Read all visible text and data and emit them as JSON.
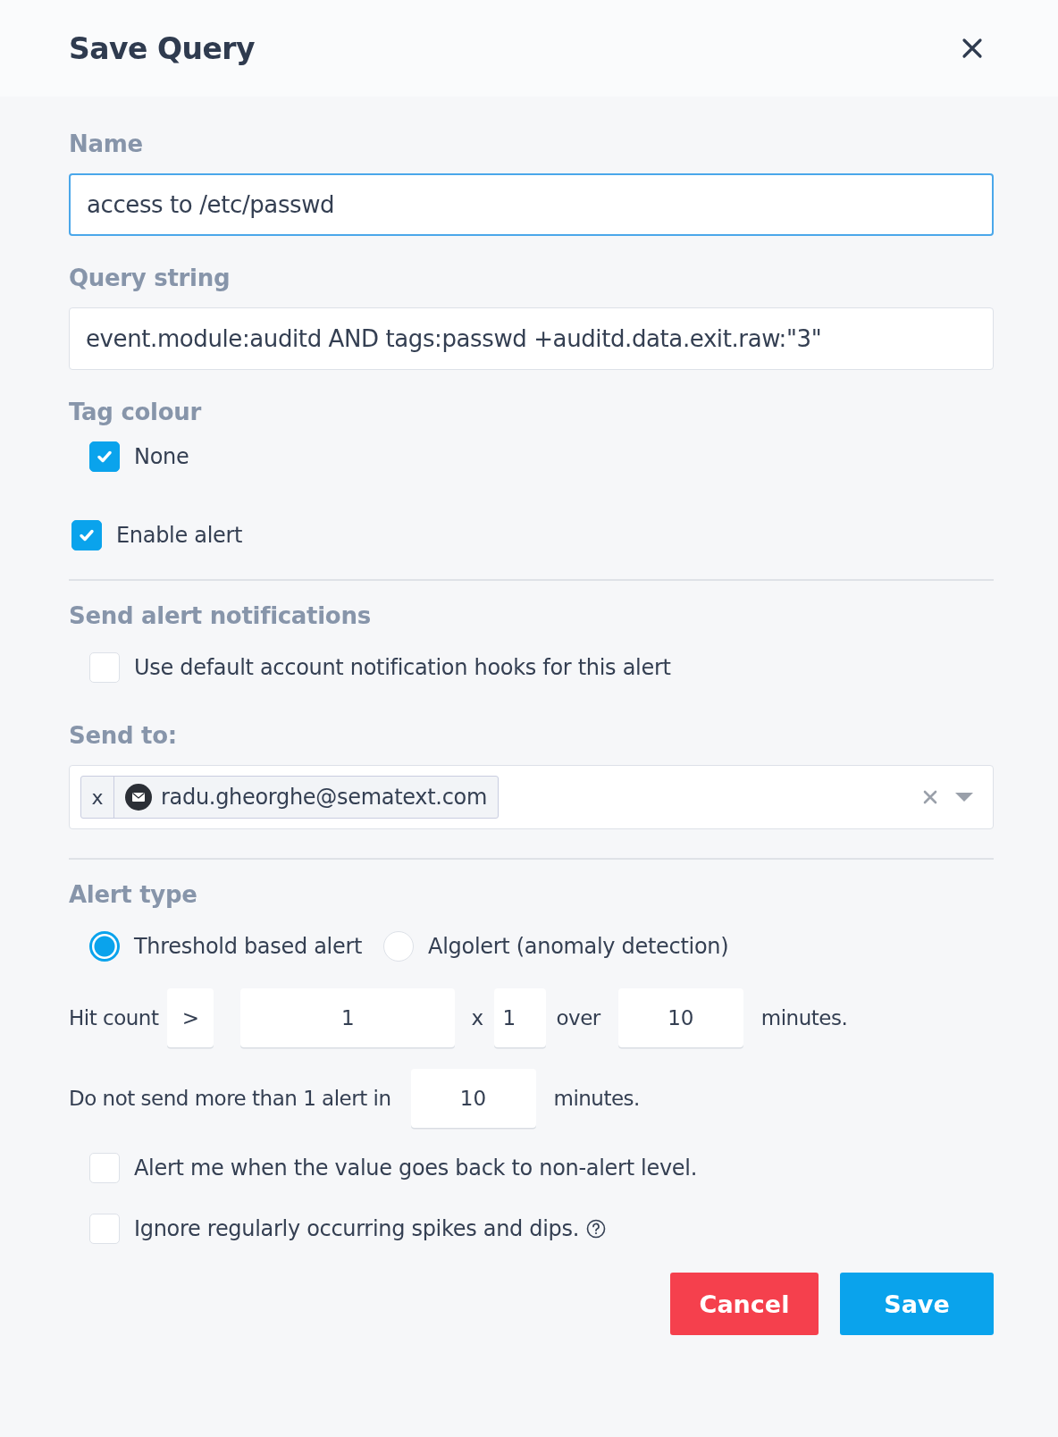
{
  "dialog": {
    "title": "Save Query"
  },
  "fields": [
    {
      "label": "Name",
      "value": "access to /etc/passwd",
      "focused": true
    },
    {
      "label": "Query string",
      "value": "event.module:auditd AND tags:passwd +auditd.data.exit.raw:\"3\"",
      "focused": false
    }
  ],
  "tag_colour": {
    "label": "Tag colour",
    "options": [
      {
        "label": "None",
        "checked": true
      }
    ]
  },
  "enable_alert": {
    "label": "Enable alert",
    "checked": true
  },
  "notifications": {
    "heading": "Send alert notifications",
    "use_default": {
      "label": "Use default account notification hooks for this alert",
      "checked": false
    },
    "send_to_label": "Send to:",
    "recipients": [
      {
        "remove": "x",
        "email": "radu.gheorghe@sematext.com"
      }
    ]
  },
  "alert_type": {
    "label": "Alert type",
    "options": [
      {
        "label": "Threshold based alert",
        "selected": true
      },
      {
        "label": "Algolert (anomaly detection)",
        "selected": false
      }
    ]
  },
  "hit_count": {
    "label": "Hit count",
    "operator": ">",
    "count": "1",
    "times": "x",
    "multiplier": "1",
    "over": "over",
    "period": "10",
    "unit": "minutes."
  },
  "rate_limit": {
    "label": "Do not send more than 1 alert in",
    "value": "10",
    "unit": "minutes."
  },
  "options": [
    {
      "label": "Alert me when the value goes back to non-alert level.",
      "checked": false,
      "help": false
    },
    {
      "label": "Ignore regularly occurring spikes and dips.",
      "checked": false,
      "help": true
    }
  ],
  "buttons": [
    {
      "label": "Cancel",
      "kind": "danger"
    },
    {
      "label": "Save",
      "kind": "primary"
    }
  ]
}
